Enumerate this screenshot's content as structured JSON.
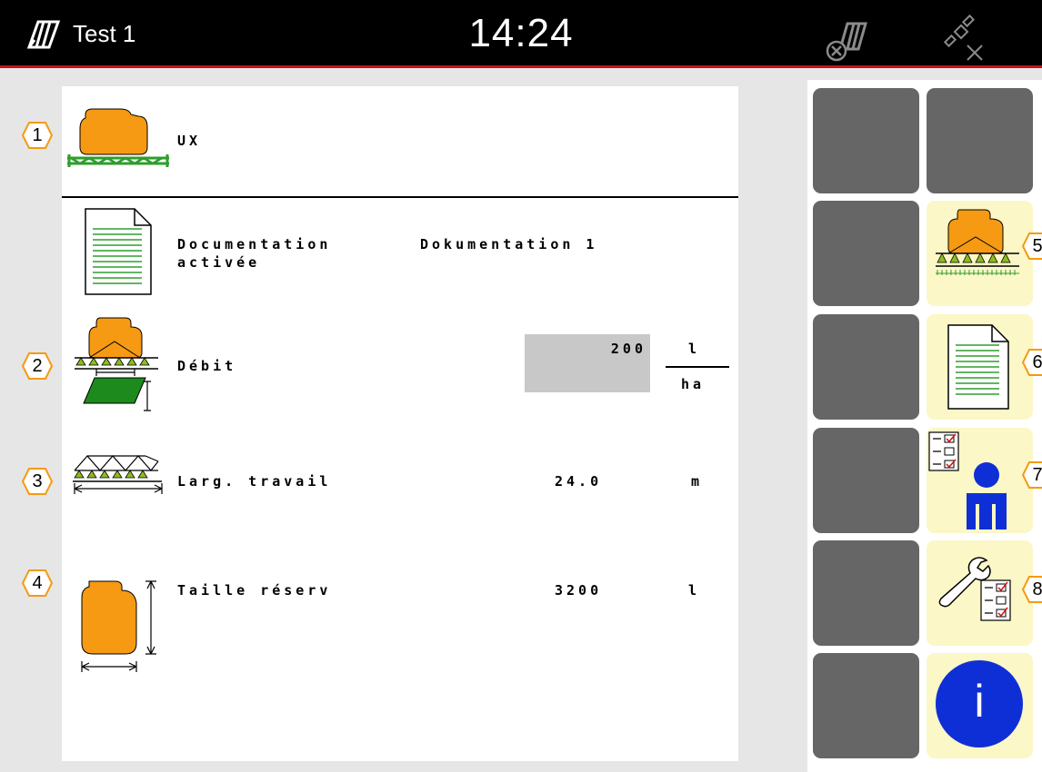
{
  "header": {
    "title": "Test 1",
    "clock": "14:24"
  },
  "machine": {
    "name": "UX",
    "callout": "1"
  },
  "rows": [
    {
      "label_line1": "Documentation",
      "label_line2": "activée",
      "value": "Dokumentation 1"
    },
    {
      "label": "Débit",
      "value": "200",
      "unit_top": "l",
      "unit_bottom": "ha",
      "callout": "2"
    },
    {
      "label": "Larg. travail",
      "value": "24.0",
      "unit": "m",
      "callout": "3"
    },
    {
      "label": "Taille réserv",
      "value": "3200",
      "unit": "l",
      "callout": "4"
    }
  ],
  "softkeys": {
    "callouts": [
      "5",
      "6",
      "7",
      "8"
    ],
    "info_glyph": "i"
  },
  "icons": {
    "top_left": "machine-profile-icon",
    "top_right_1": "section-control-off-icon",
    "top_right_2": "gps-no-signal-icon"
  },
  "colors": {
    "header_bg": "#000000",
    "header_accent": "#c8101a",
    "tank_orange": "#f59a12",
    "boom_green": "#2e9e2e",
    "softkey_gray": "#666666",
    "softkey_yellow": "#fbf7c6",
    "info_blue": "#0f2fd6"
  }
}
